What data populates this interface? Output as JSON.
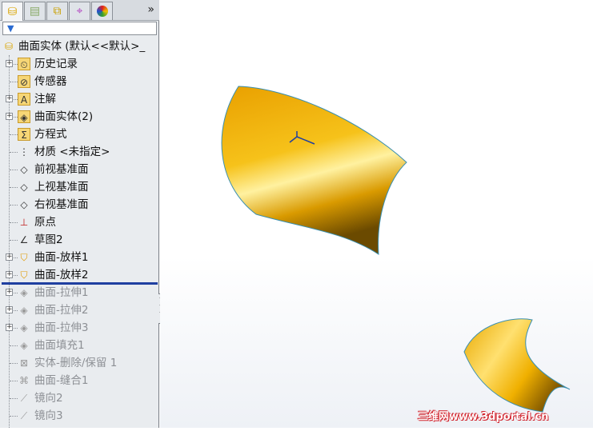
{
  "tabs": [
    {
      "name": "featuremanager",
      "icon": "feature-tree-icon"
    },
    {
      "name": "propertymanager",
      "icon": "property-icon"
    },
    {
      "name": "configurationmanager",
      "icon": "config-icon"
    },
    {
      "name": "dimxpert",
      "icon": "crosshair-icon"
    },
    {
      "name": "display",
      "icon": "appearance-icon"
    }
  ],
  "more": "»",
  "filter_icon": "filter-icon",
  "tree": {
    "root": "曲面实体  (默认<<默认>_",
    "items": [
      {
        "label": "历史记录",
        "exp": true,
        "dim": false,
        "icon": "history-icon"
      },
      {
        "label": "传感器",
        "exp": false,
        "dim": false,
        "icon": "sensor-icon"
      },
      {
        "label": "注解",
        "exp": true,
        "dim": false,
        "icon": "annotation-icon"
      },
      {
        "label": "曲面实体(2)",
        "exp": true,
        "dim": false,
        "icon": "surface-bodies-icon"
      },
      {
        "label": "方程式",
        "exp": false,
        "dim": false,
        "icon": "equation-icon"
      },
      {
        "label": "材质 <未指定>",
        "exp": false,
        "dim": false,
        "icon": "material-icon"
      },
      {
        "label": "前视基准面",
        "exp": false,
        "dim": false,
        "icon": "plane-icon"
      },
      {
        "label": "上视基准面",
        "exp": false,
        "dim": false,
        "icon": "plane-icon"
      },
      {
        "label": "右视基准面",
        "exp": false,
        "dim": false,
        "icon": "plane-icon"
      },
      {
        "label": "原点",
        "exp": false,
        "dim": false,
        "icon": "origin-icon"
      },
      {
        "label": "草图2",
        "exp": false,
        "dim": false,
        "icon": "sketch-icon"
      },
      {
        "label": "曲面-放样1",
        "exp": true,
        "dim": false,
        "icon": "loft-icon"
      },
      {
        "label": "曲面-放样2",
        "exp": true,
        "dim": false,
        "icon": "loft-icon"
      },
      {
        "label": "曲面-拉伸1",
        "exp": true,
        "dim": true,
        "icon": "extrude-icon"
      },
      {
        "label": "曲面-拉伸2",
        "exp": true,
        "dim": true,
        "icon": "extrude-icon"
      },
      {
        "label": "曲面-拉伸3",
        "exp": true,
        "dim": true,
        "icon": "extrude-icon"
      },
      {
        "label": "曲面填充1",
        "exp": false,
        "dim": true,
        "icon": "fill-icon"
      },
      {
        "label": "实体-删除/保留 1",
        "exp": false,
        "dim": true,
        "icon": "delete-body-icon"
      },
      {
        "label": "曲面-缝合1",
        "exp": false,
        "dim": true,
        "icon": "knit-icon"
      },
      {
        "label": "镜向2",
        "exp": false,
        "dim": true,
        "icon": "mirror-icon"
      },
      {
        "label": "镜向3",
        "exp": false,
        "dim": true,
        "icon": "mirror-icon"
      }
    ]
  },
  "watermark": "三维网www.3dportal.cn",
  "colors": {
    "surface": "#f2b100",
    "edge": "#3a8fb0",
    "rollback": "#1f3fa0"
  }
}
